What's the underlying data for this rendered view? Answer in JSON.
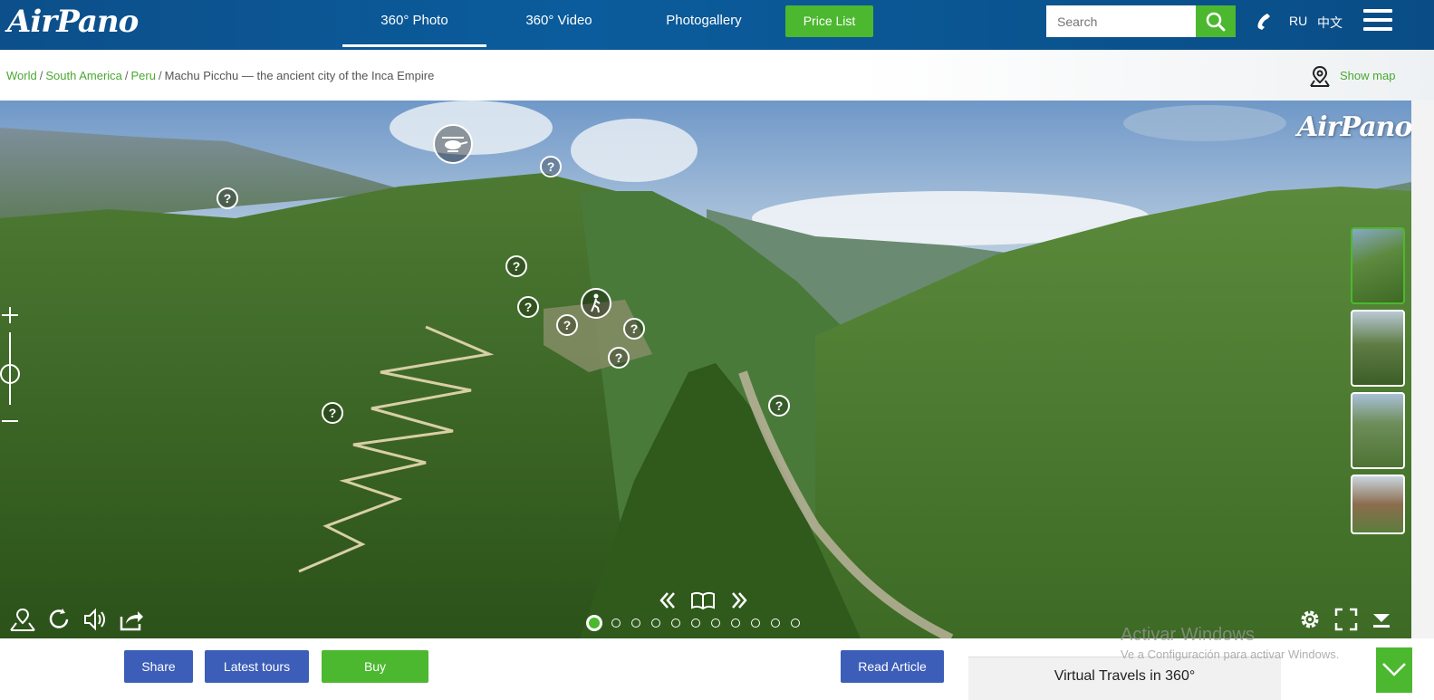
{
  "header": {
    "logo": "AirPano",
    "tabs": [
      {
        "label": "360° Photo",
        "active": true
      },
      {
        "label": "360° Video",
        "active": false
      },
      {
        "label": "Photogallery",
        "active": false
      }
    ],
    "price_button": "Price List",
    "search_placeholder": "Search",
    "lang_ru": "RU",
    "lang_zh": "中文",
    "icons": [
      "search-icon",
      "phone-icon",
      "menu-icon"
    ]
  },
  "breadcrumb": {
    "items": [
      "World",
      "South America",
      "Peru"
    ],
    "current": "Machu Picchu — the ancient city of the Inca Empire",
    "separator": "/",
    "show_map": "Show map"
  },
  "panorama": {
    "watermark": "AirPano",
    "hotspot_label": "?",
    "dot_count": 11,
    "active_dot": 0,
    "thumbnails": 4
  },
  "footer": {
    "share": "Share",
    "latest_tours": "Latest tours",
    "buy": "Buy",
    "read_article": "Read Article",
    "virtual_travels": "Virtual Travels in 360°"
  },
  "os_overlay": {
    "title": "Activar Windows",
    "subtitle": "Ve a Configuración para activar Windows."
  },
  "colors": {
    "header_blue": "#0b5c9c",
    "accent_green": "#4cb82f",
    "button_blue": "#3c5eb8",
    "link_green": "#4aa832"
  }
}
